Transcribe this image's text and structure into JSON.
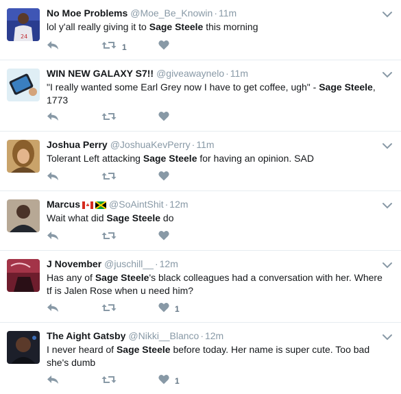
{
  "tweets": [
    {
      "name": "No Moe Problems",
      "handle": "@Moe_Be_Knowin",
      "dot": "·",
      "time": "11m",
      "text": "lol y'all really giving it to |Sage Steele| this morning",
      "retweets": "1",
      "likes": "",
      "avatar_color": "#2a3d8f",
      "icons": {
        "reply": "reply-icon",
        "retweet": "retweet-icon",
        "like": "heart-icon",
        "menu": "chevron-down-icon"
      }
    },
    {
      "name": "WIN NEW GALAXY S7!!",
      "handle": "@giveawaynelo",
      "dot": "·",
      "time": "11m",
      "text": "\"I really wanted some Earl Grey now I have to get coffee, ugh\" - |Sage Steele|, 1773",
      "retweets": "",
      "likes": "",
      "avatar_color": "#cfe3ee"
    },
    {
      "name": "Joshua Perry",
      "handle": "@JoshuaKevPerry",
      "dot": "·",
      "time": "11m",
      "text": "Tolerant Left attacking |Sage Steele| for having an opinion. SAD",
      "retweets": "",
      "likes": "",
      "avatar_color": "#9a7440"
    },
    {
      "name": "Marcus",
      "handle": "@SoAintShit",
      "dot": "·",
      "time": "12m",
      "text": "Wait what did |Sage Steele| do",
      "retweets": "",
      "likes": "",
      "avatar_color": "#6d5a4c"
    },
    {
      "name": "J November",
      "handle": "@juschill__",
      "dot": "·",
      "time": "12m",
      "text": "Has any of |Sage Steele|'s black colleagues had a conversation with her. Where tf is Jalen Rose when u need him?",
      "retweets": "",
      "likes": "1",
      "avatar_color": "#8b2a3a"
    },
    {
      "name": "The Aight Gatsby",
      "handle": "@Nikki__Blanco",
      "dot": "·",
      "time": "12m",
      "text": "I never heard of |Sage Steele| before today. Her name is super cute. Too bad she's dumb",
      "retweets": "",
      "likes": "1",
      "avatar_color": "#2b2f3a"
    }
  ],
  "colors": {
    "icon": "#8899a6",
    "name": "#14171a",
    "meta": "#8899a6",
    "divider": "#e6ecf0"
  }
}
